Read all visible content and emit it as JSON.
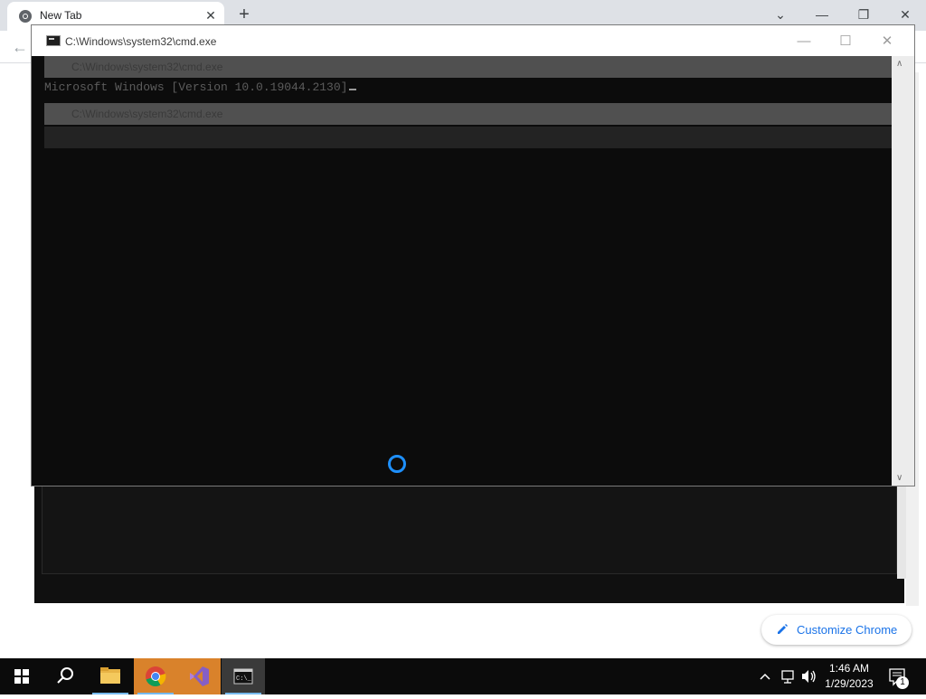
{
  "browser": {
    "tab_title": "New Tab",
    "tab_close": "✕",
    "new_tab": "+",
    "minimize": "—",
    "maximize": "❐",
    "close": "✕",
    "tab_list": "⌄",
    "back": "←",
    "customize_label": "Customize Chrome",
    "accent": "#1a73e8"
  },
  "cmd": {
    "title": "C:\\Windows\\system32\\cmd.exe",
    "minimize": "—",
    "maximize": "☐",
    "close": "✕",
    "output_line": "Microsoft Windows [Version 10.0.19044.2130]",
    "scroll_up": "∧",
    "scroll_down": "∨"
  },
  "ghost_windows": {
    "title": "C:\\Windows\\system32\\cmd.exe"
  },
  "taskbar": {
    "items": [
      {
        "name": "start",
        "icon": "windows-logo-icon"
      },
      {
        "name": "search",
        "icon": "search-icon"
      },
      {
        "name": "file-explorer",
        "icon": "folder-icon"
      },
      {
        "name": "chrome",
        "icon": "chrome-icon"
      },
      {
        "name": "visual-studio",
        "icon": "visual-studio-icon"
      },
      {
        "name": "command-prompt",
        "icon": "cmd-icon"
      }
    ],
    "time": "1:46 AM",
    "date": "1/29/2023",
    "notification_count": "1"
  }
}
